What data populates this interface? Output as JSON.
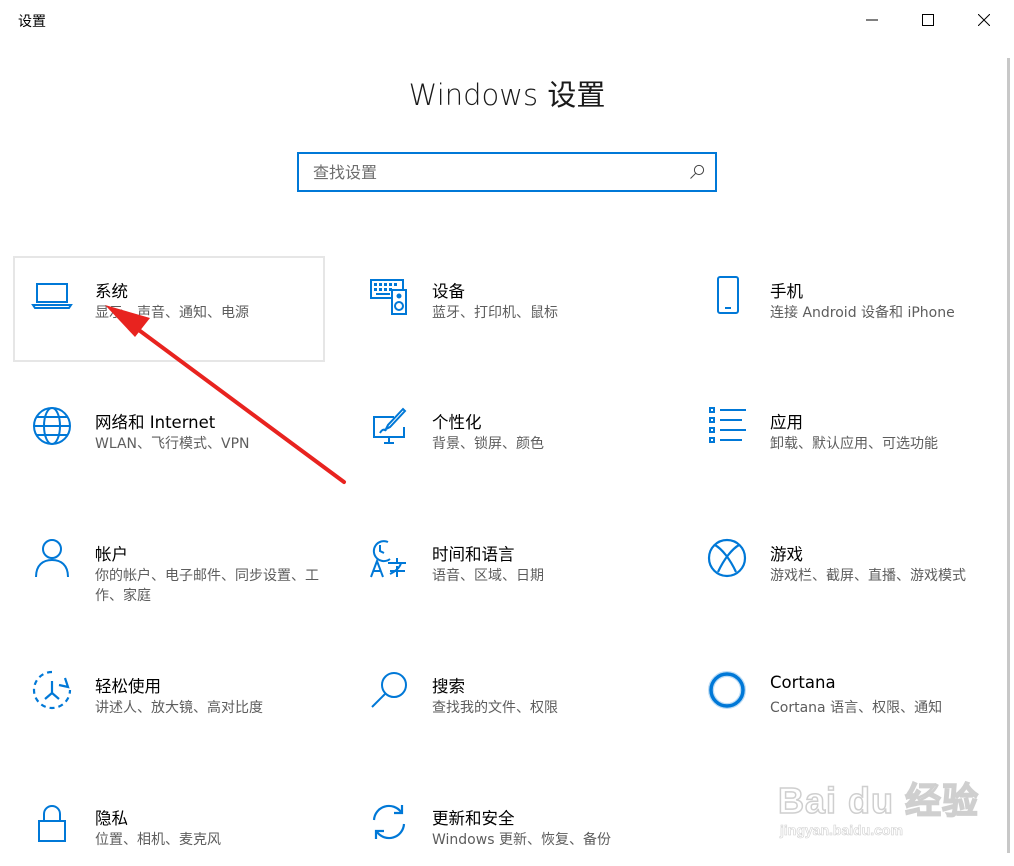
{
  "window": {
    "title": "设置",
    "minimize_icon": "minimize-icon",
    "maximize_icon": "maximize-icon",
    "close_icon": "close-icon"
  },
  "header": {
    "title": "Windows 设置"
  },
  "search": {
    "placeholder": "查找设置",
    "value": "",
    "icon": "search-icon"
  },
  "tiles": [
    {
      "id": "system",
      "title": "系统",
      "description": "显示、声音、通知、电源",
      "icon": "laptop-icon",
      "hovered": true
    },
    {
      "id": "devices",
      "title": "设备",
      "description": "蓝牙、打印机、鼠标",
      "icon": "keyboard-speaker-icon"
    },
    {
      "id": "phone",
      "title": "手机",
      "description": "连接 Android 设备和 iPhone",
      "icon": "phone-icon"
    },
    {
      "id": "network",
      "title": "网络和 Internet",
      "description": "WLAN、飞行模式、VPN",
      "icon": "globe-icon"
    },
    {
      "id": "personalization",
      "title": "个性化",
      "description": "背景、锁屏、颜色",
      "icon": "paint-monitor-icon"
    },
    {
      "id": "apps",
      "title": "应用",
      "description": "卸载、默认应用、可选功能",
      "icon": "app-list-icon"
    },
    {
      "id": "accounts",
      "title": "帐户",
      "description": "你的帐户、电子邮件、同步设置、工作、家庭",
      "icon": "person-icon"
    },
    {
      "id": "time",
      "title": "时间和语言",
      "description": "语音、区域、日期",
      "icon": "time-language-icon"
    },
    {
      "id": "gaming",
      "title": "游戏",
      "description": "游戏栏、截屏、直播、游戏模式",
      "icon": "xbox-icon"
    },
    {
      "id": "ease",
      "title": "轻松使用",
      "description": "讲述人、放大镜、高对比度",
      "icon": "ease-of-access-icon"
    },
    {
      "id": "search",
      "title": "搜索",
      "description": "查找我的文件、权限",
      "icon": "magnifier-icon"
    },
    {
      "id": "cortana",
      "title": "Cortana",
      "description": "Cortana 语言、权限、通知",
      "icon": "cortana-ring-icon"
    },
    {
      "id": "privacy",
      "title": "隐私",
      "description": "位置、相机、麦克风",
      "icon": "lock-icon"
    },
    {
      "id": "update",
      "title": "更新和安全",
      "description": "Windows 更新、恢复、备份",
      "icon": "sync-arrows-icon"
    }
  ],
  "watermark": {
    "main": "Bai du 经验",
    "sub": "jingyan.baidu.com"
  },
  "colors": {
    "accent": "#0078d7",
    "annotation_arrow": "#e8231f",
    "hover_border": "#e6e6e6"
  }
}
